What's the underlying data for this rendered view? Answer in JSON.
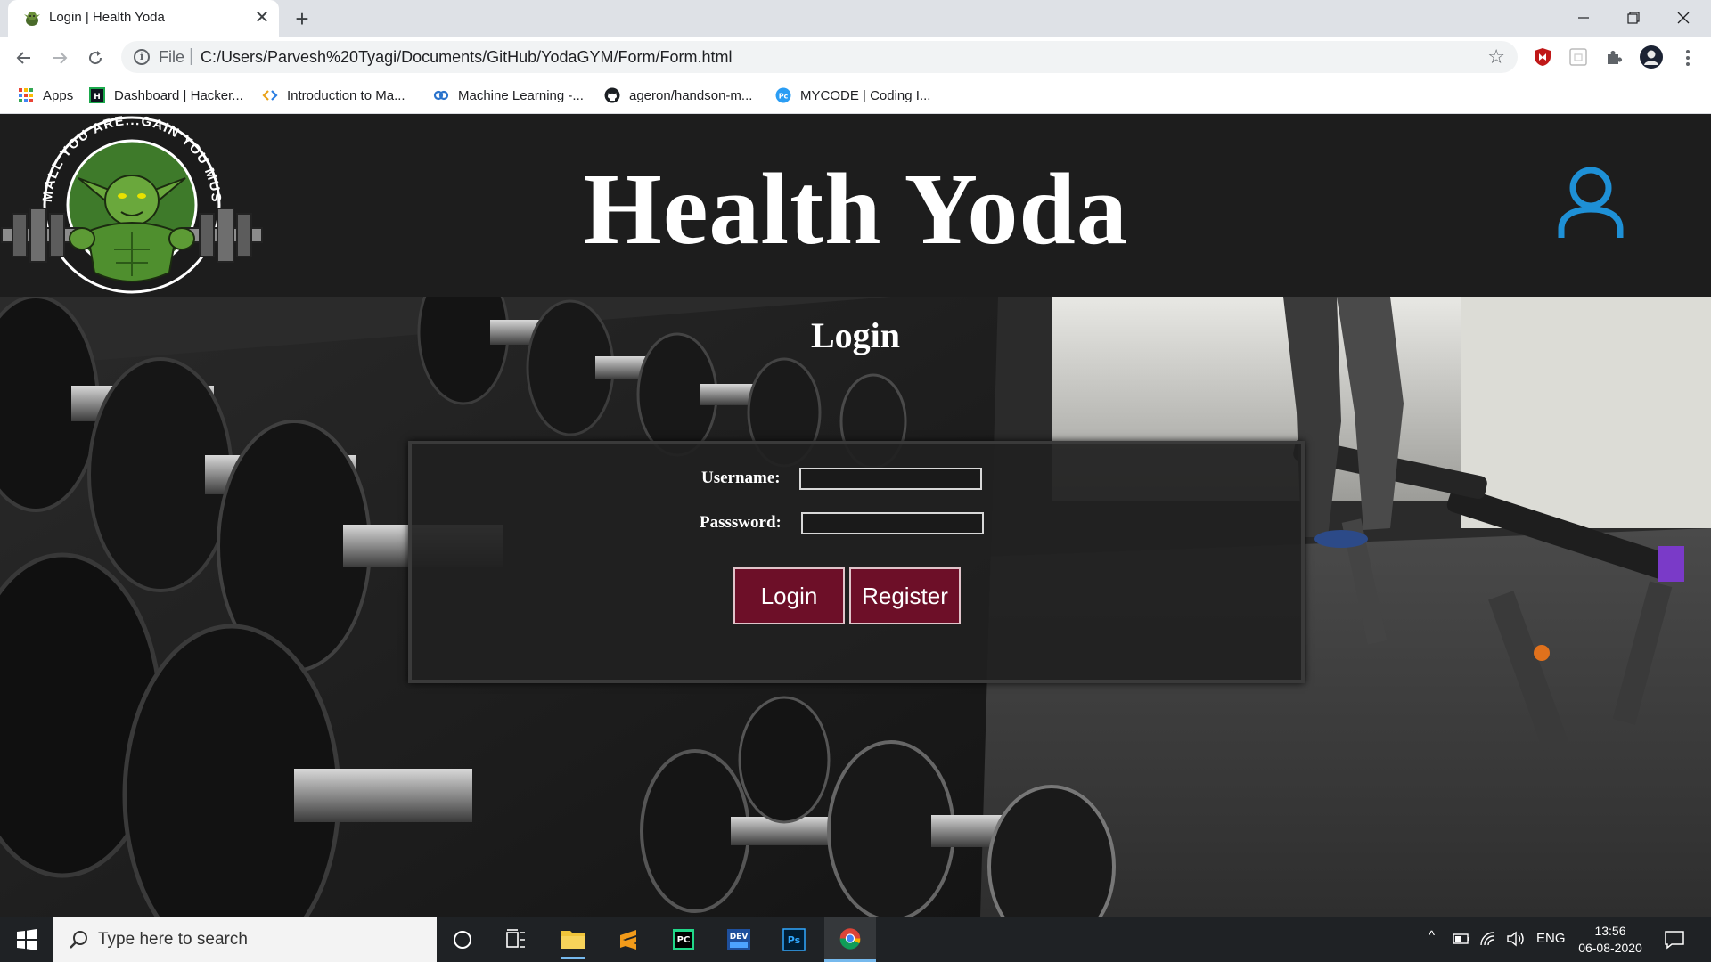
{
  "browser": {
    "tab_title": "Login | Health Yoda",
    "tab_close_glyph": "✕",
    "new_tab_glyph": "+",
    "url_scheme": "File",
    "url_separator": "|",
    "url": "C:/Users/Parvesh%20Tyagi/Documents/GitHub/YodaGYM/Form/Form.html",
    "bookmarks": [
      {
        "label": "Apps",
        "icon": "apps-grid-icon"
      },
      {
        "label": "Dashboard | Hacker...",
        "icon": "hackerrank-icon"
      },
      {
        "label": "Introduction to Ma...",
        "icon": "code-icon"
      },
      {
        "label": "Machine Learning -...",
        "icon": "coursera-icon"
      },
      {
        "label": "ageron/handson-m...",
        "icon": "github-icon"
      },
      {
        "label": "MYCODE | Coding I...",
        "icon": "mycode-icon"
      }
    ]
  },
  "site": {
    "title": "Health Yoda",
    "logo_text": "SMALL YOU ARE...GAIN YOU MUST",
    "login_heading": "Login",
    "form": {
      "username_label": "Username:",
      "password_label": "Passsword:",
      "username_value": "",
      "password_value": "",
      "login_button": "Login",
      "register_button": "Register"
    }
  },
  "taskbar": {
    "search_placeholder": "Type here to search",
    "language": "ENG",
    "time": "13:56",
    "date": "06-08-2020"
  },
  "colors": {
    "header_bg": "#1d1d1d",
    "user_icon": "#1e90d6",
    "button_bg": "#6d0f28",
    "chrome_tabstrip": "#dee1e6"
  }
}
